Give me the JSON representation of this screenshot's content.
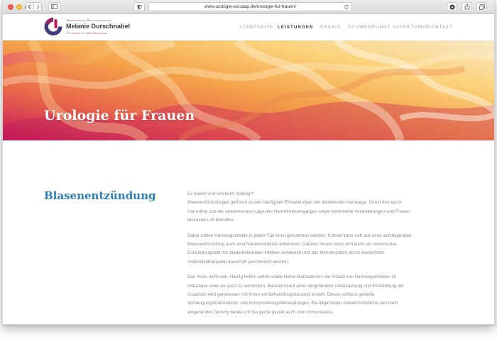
{
  "browser": {
    "url": "www.urologie-esculap.de/urologie-für-frauen/",
    "icons": {
      "back": "chevron-left-icon",
      "forward": "chevron-right-icon",
      "sidebar": "sidebar-icon",
      "privacy": "shield-icon",
      "reload": "reload-icon",
      "download": "download-icon",
      "share": "share-icon",
      "tabs": "tabs-icon"
    }
  },
  "header": {
    "brand_small": "Urologische Privatarztpraxis",
    "brand_name": "Melanie Durschnabel",
    "brand_sub": "Fachärztin für Urologie",
    "logo_colors": [
      "#c2185b",
      "#3f3a7a",
      "#e07a3a"
    ],
    "nav": [
      {
        "label": "STARTSEITE",
        "active": false
      },
      {
        "label": "LEISTUNGEN",
        "active": true
      },
      {
        "label": "PRAXIS",
        "active": false
      },
      {
        "label": "SCHWERPUNKT VASEKTOMIE",
        "active": false
      },
      {
        "label": "KONTAKT",
        "active": false
      }
    ]
  },
  "hero": {
    "title": "Urologie für Frauen",
    "gradient_colors": [
      "#c2185b",
      "#e8654a",
      "#f4a24a",
      "#fbd27a",
      "#f8e8c8"
    ]
  },
  "content": {
    "section_title": "Blasenentzündung",
    "paragraphs": [
      {
        "lines": [
          "Es brennt und schmerzt ständig?!",
          "Blasenentzündungen gehören zu den häufigsten Erkrankungen der ableitenden Harnwege. Durch ihre kurze",
          "Harnröhre und der anatomischen Lage des Harnröhreneinganges sowie hormonelle Veränderungen sind Frauen",
          "besonders oft betroffen."
        ]
      },
      {
        "lines": [
          "Dabei sollten Harnwegsinfekte in jedem Fall ernst genommen werden. Schnell kann sich aus einer aufsteigenden",
          "Blasenentzündung auch eine Nierenkrankheit entwickeln. Darüber hinaus kann sich leicht ein chronisches",
          "Entzündungsbild mit wiederkehrenden Infekten entwickelt und das Immunsystem durch wiederholte",
          "Antibiotikatherapien dauerhaft geschwächt werden."
        ]
      },
      {
        "lines": [
          "Das muss nicht sein. Häufig helfen schon relativ kleine Maßnahmen, die Anzahl von Harnwegsinfekten zu",
          "reduzieren oder sie ganz zu verhindern. Basierend auf einer eingehenden Untersuchung und Feststellung der",
          "Ursachen wird gemeinsam mit Ihnen ein Behandlungskonzept erstellt. Dieses umfasst gezielte",
          "Vorbeugungsmaßnahmen und Immunisierungsbehandlungen. Bei allgemeiner Abwehrschwäche und nach",
          "eingehender Testung berate ich Sie gerne gezielt auch zum Immunstatus."
        ]
      }
    ]
  }
}
